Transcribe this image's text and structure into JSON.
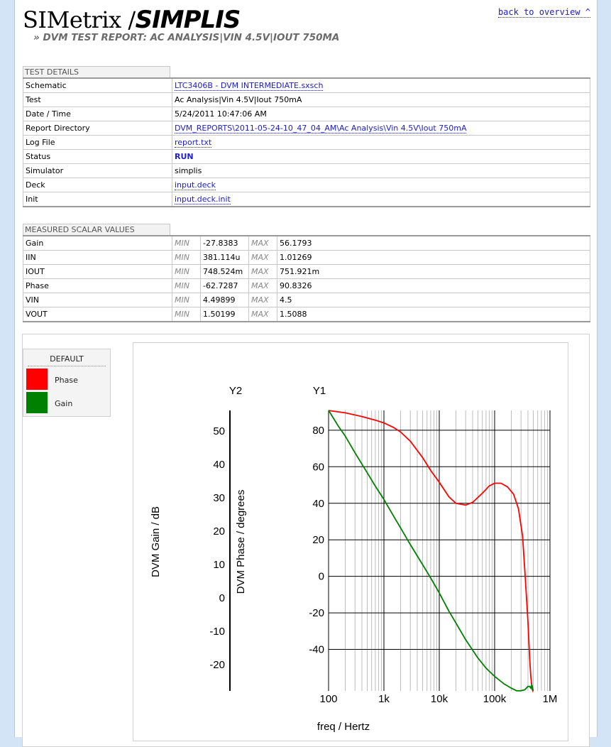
{
  "header": {
    "logo_simetrix": "SIMetrix /",
    "logo_simplis": "SIMPLIS",
    "subtitle": "» DVM TEST REPORT: AC ANALYSIS|VIN 4.5V|IOUT 750MA",
    "back_link": "back to overview ^"
  },
  "test_details": {
    "title": "TEST DETAILS",
    "rows": [
      {
        "label": "Schematic",
        "value": "LTC3406B - DVM INTERMEDIATE.sxsch"
      },
      {
        "label": "Test",
        "value": "Ac Analysis|Vin 4.5V|Iout 750mA"
      },
      {
        "label": "Date / Time",
        "value": "5/24/2011 10:47:06 AM"
      },
      {
        "label": "Report Directory",
        "value": "DVM_REPORTS\\2011-05-24-10_47_04_AM\\Ac Analysis\\Vin 4.5V\\Iout 750mA"
      },
      {
        "label": "Log File",
        "value": "report.txt"
      },
      {
        "label": "Status",
        "value": "RUN"
      },
      {
        "label": "Simulator",
        "value": "simplis"
      },
      {
        "label": "Deck",
        "value": "input.deck"
      },
      {
        "label": "Init",
        "value": "input.deck.init"
      }
    ]
  },
  "scalars": {
    "title": "MEASURED SCALAR VALUES",
    "min_label": "MIN",
    "max_label": "MAX",
    "rows": [
      {
        "name": "Gain",
        "min": "-27.8383",
        "max": "56.1793"
      },
      {
        "name": "IIN",
        "min": "381.114u",
        "max": "1.01269"
      },
      {
        "name": "IOUT",
        "min": "748.524m",
        "max": "751.921m"
      },
      {
        "name": "Phase",
        "min": "-62.7287",
        "max": "90.8326"
      },
      {
        "name": "VIN",
        "min": "4.49899",
        "max": "4.5"
      },
      {
        "name": "VOUT",
        "min": "1.50199",
        "max": "1.5088"
      }
    ]
  },
  "legend": {
    "title": "DEFAULT",
    "items": [
      {
        "name": "Phase",
        "color": "#ff0000"
      },
      {
        "name": "Gain",
        "color": "#008000"
      }
    ]
  },
  "chart_data": {
    "type": "line",
    "x_scale": "log",
    "xlabel": "freq / Hertz",
    "xlim": [
      100,
      1000000
    ],
    "x_ticks": [
      "100",
      "1k",
      "10k",
      "100k",
      "1M"
    ],
    "y1": {
      "title": "Y1",
      "label": "DVM Phase / degrees",
      "ylim": [
        -62.7287,
        90.8326
      ],
      "ticks": [
        80,
        60,
        40,
        20,
        0,
        -20,
        -40
      ]
    },
    "y2": {
      "title": "Y2",
      "label": "DVM Gain / dB",
      "ylim": [
        -27.8383,
        56.1793
      ],
      "ticks": [
        50,
        40,
        30,
        20,
        10,
        0,
        -10,
        -20
      ]
    },
    "grid": true,
    "series": [
      {
        "name": "Phase",
        "axis": "y1",
        "color": "#ff0000",
        "x": [
          100,
          200,
          400,
          700,
          1000,
          1500,
          2000,
          3000,
          5000,
          7000,
          10000,
          15000,
          20000,
          30000,
          40000,
          60000,
          80000,
          100000,
          130000,
          170000,
          220000,
          270000,
          320000,
          360000,
          400000,
          430000,
          450000,
          470000,
          480000,
          490000,
          500000
        ],
        "y": [
          90.8,
          89.5,
          87.5,
          85.5,
          84,
          81.5,
          79,
          74,
          65,
          58,
          51.5,
          43.5,
          40,
          39,
          40.5,
          45.5,
          49.5,
          51,
          51,
          49,
          45,
          37,
          22,
          -2,
          -25,
          -45,
          -55,
          -60,
          -62,
          -62.7,
          -62
        ]
      },
      {
        "name": "Gain",
        "axis": "y2",
        "color": "#008000",
        "x": [
          100,
          150,
          200,
          300,
          500,
          700,
          1000,
          1500,
          2000,
          3000,
          5000,
          7000,
          10000,
          15000,
          20000,
          30000,
          50000,
          70000,
          100000,
          150000,
          200000,
          250000,
          300000,
          350000,
          400000,
          430000,
          450000,
          470000,
          480000,
          490000,
          500000
        ],
        "y": [
          56.2,
          51.5,
          48.5,
          43.5,
          37.5,
          33.5,
          29.5,
          24.5,
          21,
          16,
          10,
          6,
          1.5,
          -4,
          -7.5,
          -12.5,
          -18,
          -21,
          -23.5,
          -25.8,
          -27,
          -27.8,
          -27.8,
          -27.5,
          -26.5,
          -26.5,
          -27,
          -26,
          -26.5,
          -27.5,
          -27.8
        ]
      }
    ]
  }
}
